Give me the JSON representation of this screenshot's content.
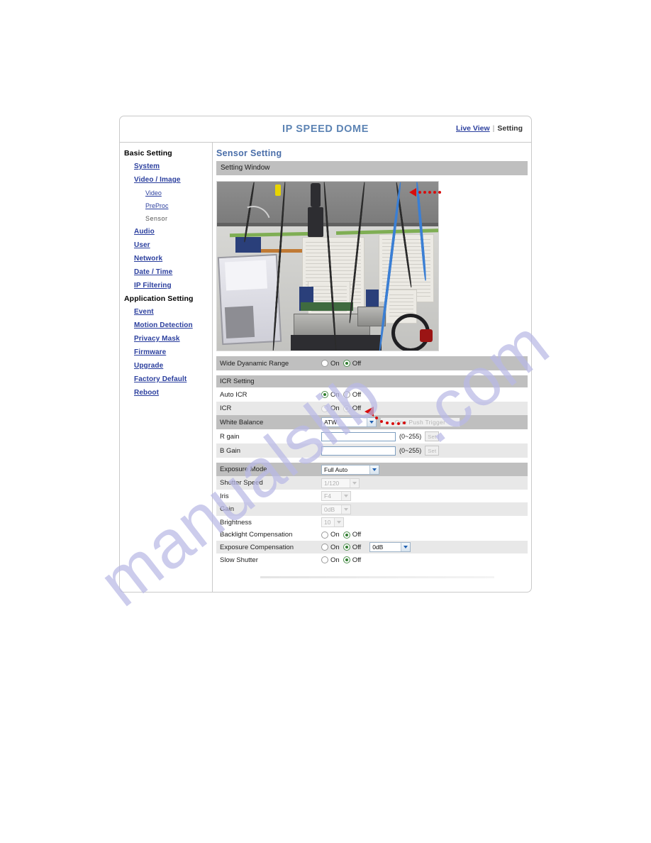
{
  "watermark": {
    "line1": "manualslib",
    "line2": ".com",
    "color": "#b9b9e6"
  },
  "header": {
    "brand": "IP SPEED DOME",
    "live_view": "Live View",
    "separator": "|",
    "current": "Setting"
  },
  "sidebar": {
    "groups": [
      {
        "heading": "Basic Setting",
        "items": [
          {
            "label": "System",
            "level": 1,
            "active": false
          },
          {
            "label": "Video / Image",
            "level": 1,
            "active": false
          },
          {
            "label": "Video",
            "level": 2,
            "active": false
          },
          {
            "label": "PreProc",
            "level": 2,
            "active": false
          },
          {
            "label": "Sensor",
            "level": 2,
            "active": true
          },
          {
            "label": "Audio",
            "level": 1,
            "active": false
          },
          {
            "label": "User",
            "level": 1,
            "active": false
          },
          {
            "label": "Network",
            "level": 1,
            "active": false
          },
          {
            "label": "Date / Time",
            "level": 1,
            "active": false
          },
          {
            "label": "IP Filtering",
            "level": 1,
            "active": false
          }
        ]
      },
      {
        "heading": "Application Setting",
        "items": [
          {
            "label": "Event",
            "level": 1,
            "active": false
          },
          {
            "label": "Motion Detection",
            "level": 1,
            "active": false
          },
          {
            "label": "Privacy Mask",
            "level": 1,
            "active": false
          },
          {
            "label": "Firmware",
            "level": 1,
            "active": false
          },
          {
            "label": "Upgrade",
            "level": 1,
            "active": false
          },
          {
            "label": "Factory Default",
            "level": 1,
            "active": false
          },
          {
            "label": "Reboot",
            "level": 1,
            "active": false
          }
        ]
      }
    ]
  },
  "main": {
    "title": "Sensor Setting",
    "window_bar": "Setting Window",
    "video_alt": "live camera preview of equipment room ceiling with cables",
    "rows": {
      "wide_dynamic_range": {
        "label": "Wide Dyanamic Range",
        "on": "On",
        "off": "Off",
        "selected": "Off",
        "enabled": true
      },
      "icr_section": {
        "label": "ICR Setting"
      },
      "auto_icr": {
        "label": "Auto ICR",
        "on": "On",
        "off": "Off",
        "selected": "On",
        "enabled": true
      },
      "icr": {
        "label": "ICR",
        "on": "On",
        "off": "Off",
        "selected": "Off",
        "enabled": false
      },
      "white_balance": {
        "label": "White Balance",
        "value": "ATW",
        "options": [
          "ATW"
        ],
        "button": "One Push Trigger",
        "button_enabled": false
      },
      "r_gain": {
        "label": "R gain",
        "value": "",
        "range": "(0~255)",
        "button": "Set",
        "button_enabled": false
      },
      "b_gain": {
        "label": "B Gain",
        "value": "",
        "range": "(0~255)",
        "button": "Set",
        "button_enabled": false
      },
      "exposure_mode": {
        "label": "Exposure Mode",
        "value": "Full Auto",
        "options": [
          "Full Auto"
        ],
        "enabled": true
      },
      "shutter_speed": {
        "label": "Shutter Speed",
        "value": "1/120",
        "enabled": false
      },
      "iris": {
        "label": "Iris",
        "value": "F4",
        "enabled": false
      },
      "gain": {
        "label": "Gain",
        "value": "0dB",
        "enabled": false
      },
      "brightness": {
        "label": "Brightness",
        "value": "10",
        "enabled": false
      },
      "backlight_compensation": {
        "label": "Backlight Compensation",
        "on": "On",
        "off": "Off",
        "selected": "Off",
        "enabled": true
      },
      "exposure_compensation": {
        "label": "Exposure Compensation",
        "on": "On",
        "off": "Off",
        "selected": "Off",
        "enabled": true,
        "value": "0dB",
        "options": [
          "0dB"
        ]
      },
      "slow_shutter": {
        "label": "Slow Shutter",
        "on": "On",
        "off": "Off",
        "selected": "Off",
        "enabled": true
      }
    }
  },
  "annotations": [
    {
      "name": "arrow-video-top-right",
      "note": "red left-pointing arrow with dotted tail over video"
    },
    {
      "name": "arrow-auto-icr",
      "note": "red left-pointing arrow with dotted tail near Auto ICR"
    }
  ]
}
